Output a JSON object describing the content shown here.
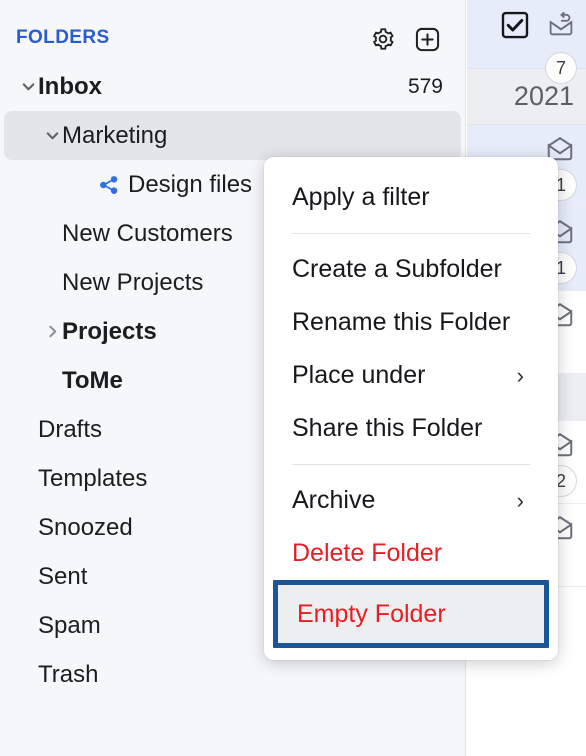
{
  "sidebar": {
    "title": "FOLDERS",
    "header_icons": [
      {
        "name": "settings-gear-icon",
        "glyph": "gear"
      },
      {
        "name": "add-folder-icon",
        "glyph": "plus-square"
      }
    ],
    "items": [
      {
        "label": "Inbox",
        "indent": 0,
        "chevron": "down",
        "bold": true,
        "count": "579",
        "selected": false,
        "icon": null
      },
      {
        "label": "Marketing",
        "indent": 1,
        "chevron": "down",
        "bold": false,
        "count": "",
        "selected": true,
        "icon": null
      },
      {
        "label": "Design files",
        "indent": 2,
        "chevron": "none",
        "bold": false,
        "count": "",
        "selected": false,
        "icon": "share-icon"
      },
      {
        "label": "New Customers",
        "indent": 1,
        "chevron": "none",
        "bold": false,
        "count": "",
        "selected": false,
        "icon": null
      },
      {
        "label": "New Projects",
        "indent": 1,
        "chevron": "none",
        "bold": false,
        "count": "",
        "selected": false,
        "icon": null
      },
      {
        "label": "Projects",
        "indent": 1,
        "chevron": "right",
        "bold": true,
        "count": "",
        "selected": false,
        "icon": null
      },
      {
        "label": "ToMe",
        "indent": 1,
        "chevron": "none",
        "bold": true,
        "count": "",
        "selected": false,
        "icon": null
      },
      {
        "label": "Drafts",
        "indent": 0,
        "chevron": "none",
        "bold": false,
        "count": "",
        "selected": false,
        "icon": null
      },
      {
        "label": "Templates",
        "indent": 0,
        "chevron": "none",
        "bold": false,
        "count": "",
        "selected": false,
        "icon": null
      },
      {
        "label": "Snoozed",
        "indent": 0,
        "chevron": "none",
        "bold": false,
        "count": "",
        "selected": false,
        "icon": null
      },
      {
        "label": "Sent",
        "indent": 0,
        "chevron": "none",
        "bold": false,
        "count": "",
        "selected": false,
        "icon": null
      },
      {
        "label": "Spam",
        "indent": 0,
        "chevron": "none",
        "bold": false,
        "count": "",
        "selected": false,
        "icon": null
      },
      {
        "label": "Trash",
        "indent": 0,
        "chevron": "none",
        "bold": false,
        "count": "",
        "selected": false,
        "icon": null
      }
    ]
  },
  "maillist": {
    "toolbar": {
      "select_all_checked": true,
      "mark_unread_icon": "envelope-reply-icon",
      "badge": "7"
    },
    "date_header": "2021",
    "rows": [
      {
        "type": "message",
        "unread": true,
        "badge": "1"
      },
      {
        "type": "message",
        "unread": true,
        "badge": "1"
      },
      {
        "type": "message",
        "unread": false,
        "badge": ""
      },
      {
        "type": "group",
        "unread": false,
        "badge": ""
      },
      {
        "type": "message",
        "unread": false,
        "badge": "2"
      },
      {
        "type": "message",
        "unread": false,
        "badge": ""
      }
    ]
  },
  "context_menu": {
    "items": [
      {
        "label": "Apply a filter",
        "kind": "item",
        "submenu": false,
        "highlighted": false
      },
      {
        "label": "",
        "kind": "separator",
        "submenu": false,
        "highlighted": false
      },
      {
        "label": "Create a Subfolder",
        "kind": "item",
        "submenu": false,
        "highlighted": false
      },
      {
        "label": "Rename this Folder",
        "kind": "item",
        "submenu": false,
        "highlighted": false
      },
      {
        "label": "Place under",
        "kind": "item",
        "submenu": true,
        "highlighted": false
      },
      {
        "label": "Share this Folder",
        "kind": "item",
        "submenu": false,
        "highlighted": false
      },
      {
        "label": "",
        "kind": "separator",
        "submenu": false,
        "highlighted": false
      },
      {
        "label": "Archive",
        "kind": "item",
        "submenu": true,
        "highlighted": false
      },
      {
        "label": "Delete Folder",
        "kind": "danger",
        "submenu": false,
        "highlighted": false
      },
      {
        "label": "Empty Folder",
        "kind": "danger",
        "submenu": false,
        "highlighted": true
      }
    ],
    "submenu_arrow": "›",
    "highlight_border_color": "#1a5597"
  },
  "colors": {
    "accent_blue": "#2a5bd7",
    "danger_red": "#ec1c24",
    "sidebar_bg": "#f6f7f9",
    "selected_row": "#e4e5e8",
    "unread_row": "#e6ecfa"
  }
}
